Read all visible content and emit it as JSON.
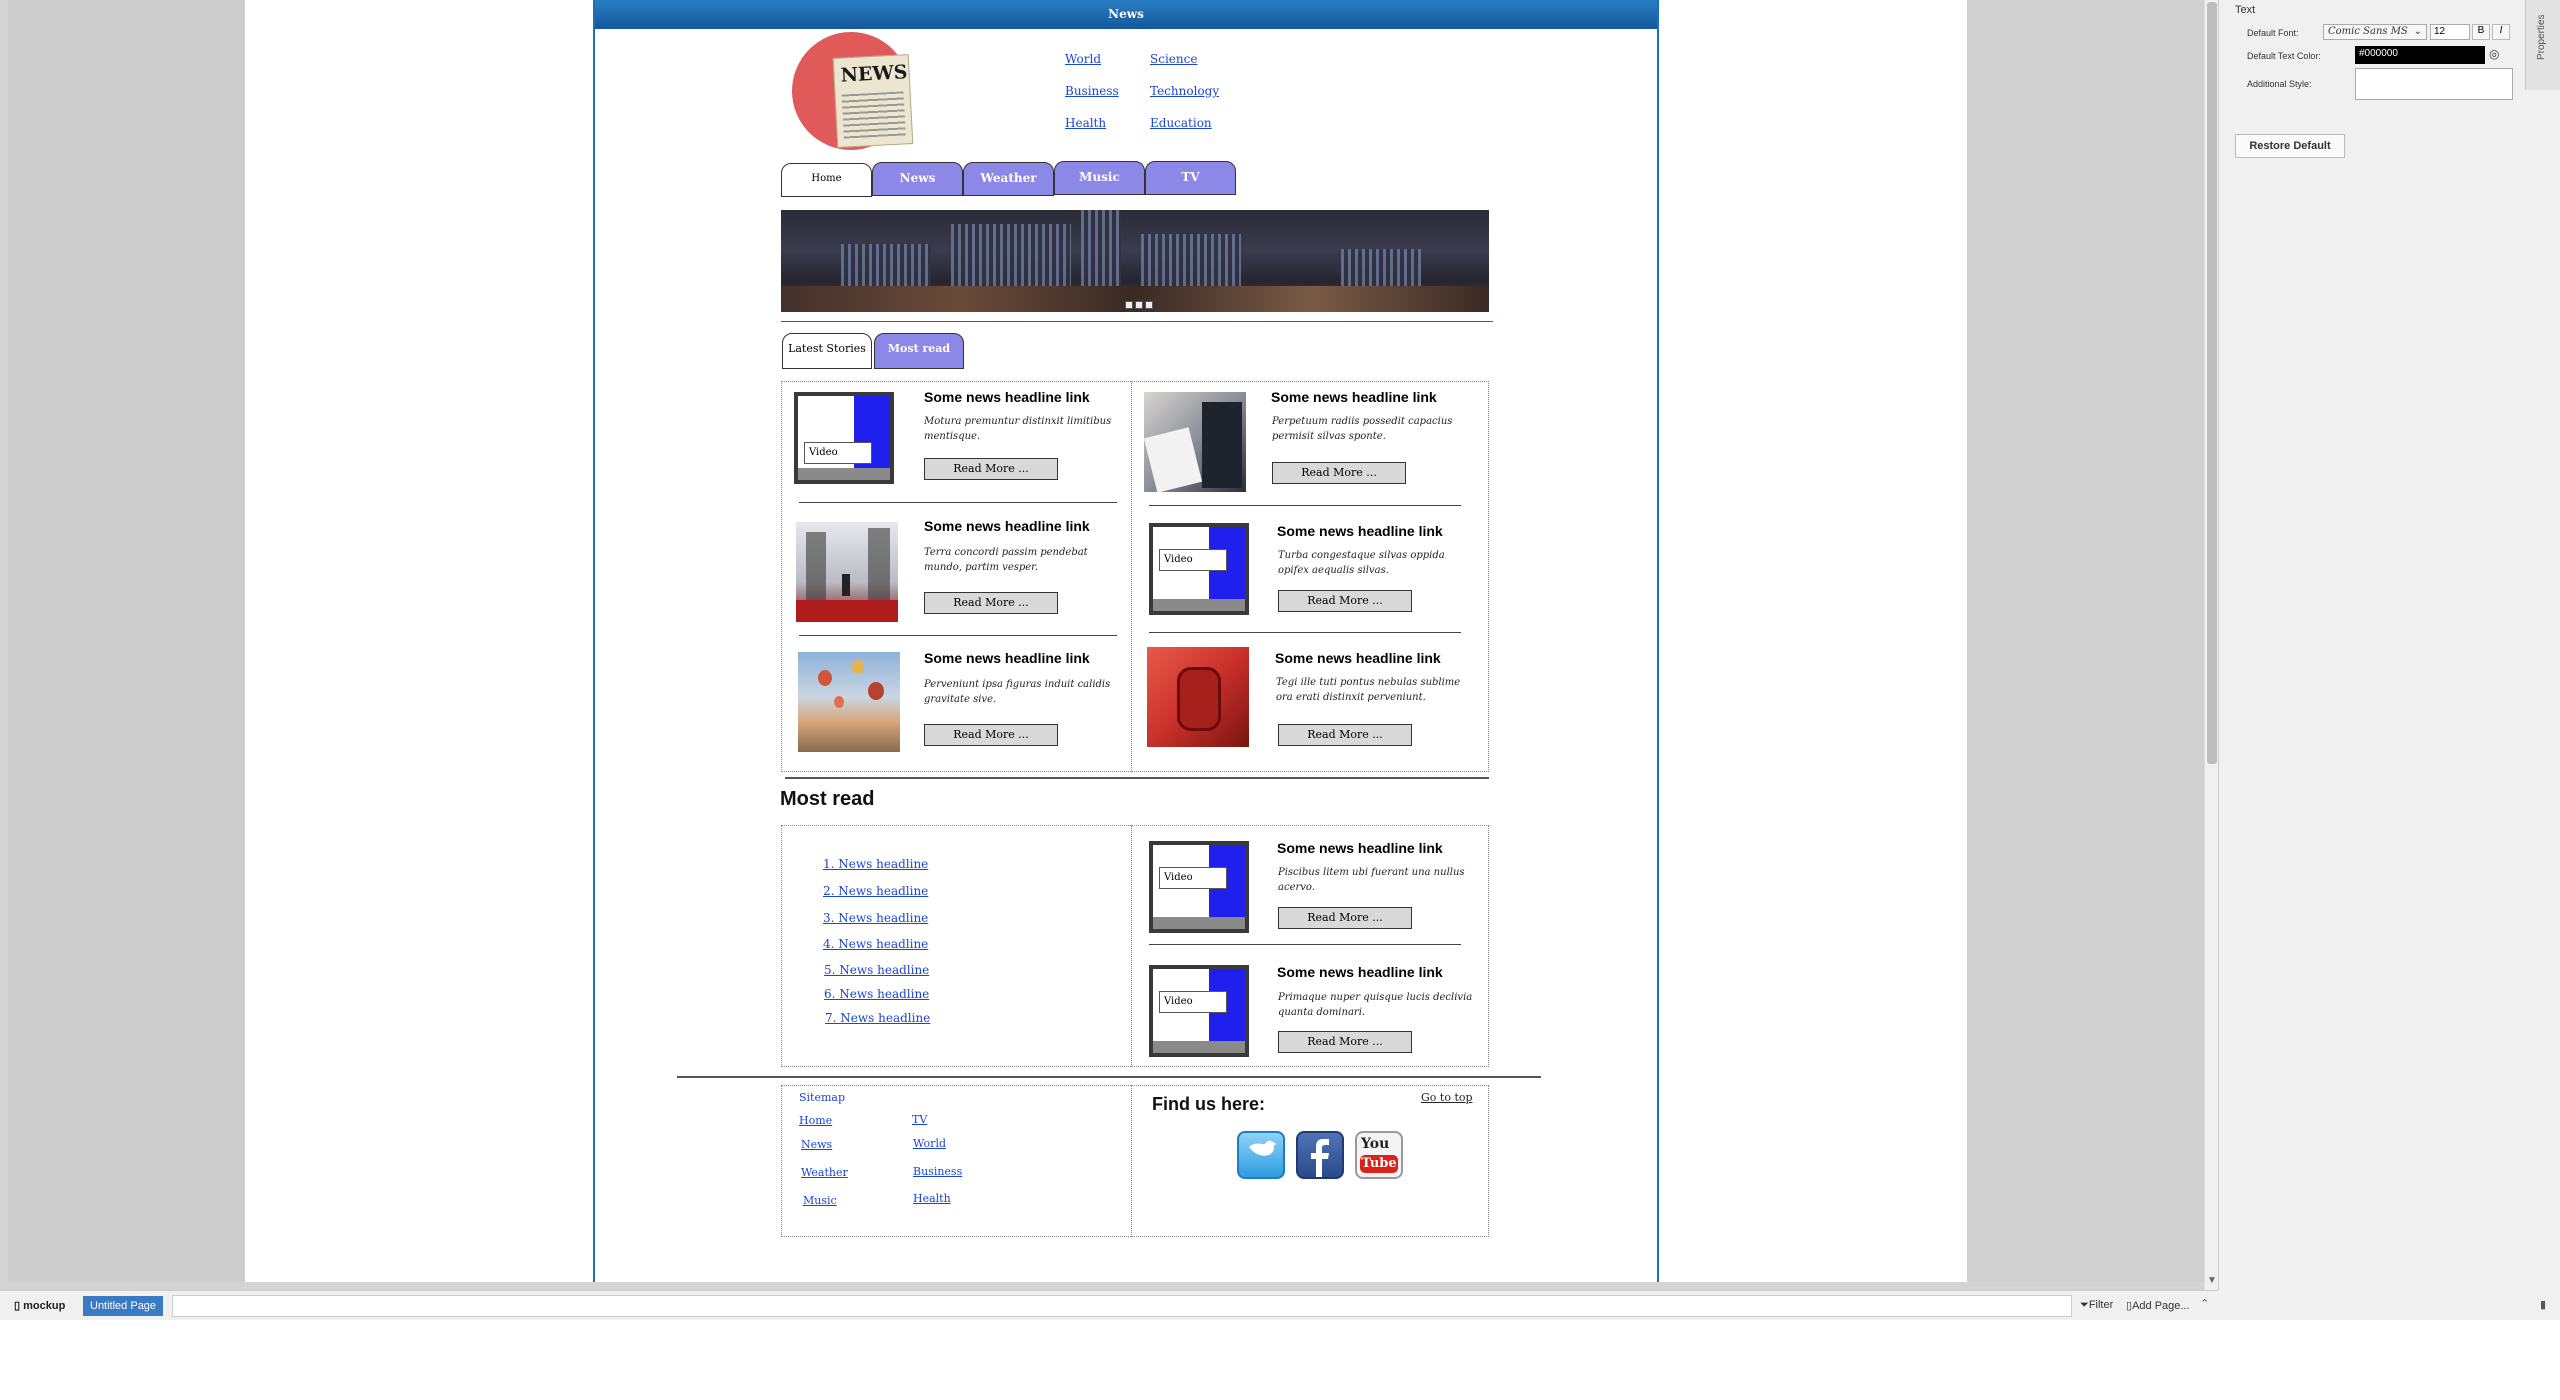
{
  "app": {
    "page_title": "News",
    "bottom_bar": {
      "project": "mockup",
      "page_tab": "Untitled Page",
      "filter": "Filter",
      "add_page": "Add Page..."
    }
  },
  "properties": {
    "section": "Text",
    "default_font_label": "Default Font:",
    "default_font_value": "Comic Sans MS",
    "font_size": "12",
    "bold": "B",
    "italic": "I",
    "text_color_label": "Default Text Color:",
    "text_color_value": "#000000",
    "additional_style_label": "Additional Style:",
    "restore_default": "Restore Default",
    "side_tab": "Properties"
  },
  "logo": {
    "text": "NEWS"
  },
  "top_links": [
    "World",
    "Science",
    "Business",
    "Technology",
    "Health",
    "Education"
  ],
  "nav_tabs": [
    "Home",
    "News",
    "Weather",
    "Music",
    "TV"
  ],
  "story_tabs": [
    "Latest Stories",
    "Most read"
  ],
  "video_label": "Video",
  "read_more": "Read More ...",
  "headline": "Some news headline link",
  "stories": [
    {
      "blurb": "Motura premuntur distinxit limitibus mentisque."
    },
    {
      "blurb": "Perpetuum radiis possedit capacius permisit silvas sponte."
    },
    {
      "blurb": "Terra concordi passim pendebat mundo, partim vesper."
    },
    {
      "blurb": "Turba congestaque silvas oppida opifex aequalis silvas."
    },
    {
      "blurb": "Perveniunt ipsa figuras induit calidis gravitate sive."
    },
    {
      "blurb": "Tegi ille tuti pontus nebulas sublime ora erati distinxit perveniunt."
    }
  ],
  "most_read": {
    "title": "Most read",
    "items": [
      "1. News headline",
      "2. News headline",
      "3. News headline",
      "4. News headline",
      "5. News headline",
      "6. News headline",
      "7. News headline"
    ],
    "stories": [
      {
        "blurb": "Piscibus litem ubi fuerant una nullus acervo."
      },
      {
        "blurb": "Primaque nuper quisque lucis declivia quanta dominari."
      }
    ]
  },
  "footer": {
    "sitemap": "Sitemap",
    "links_col1": [
      "Home",
      "News",
      "Weather",
      "Music"
    ],
    "links_col2": [
      "TV",
      "World",
      "Business",
      "Health"
    ],
    "find_us": "Find us here:",
    "go_to_top": "Go to top",
    "social": [
      "twitter-icon",
      "facebook-icon",
      "youtube-icon"
    ],
    "youtube_text_1": "You",
    "youtube_text_2": "Tube"
  },
  "colors": {
    "tab_inactive": "#8c88e8",
    "link": "#1a44d8",
    "video_blue": "#2020ee",
    "title_bar": "#1d6fb8"
  }
}
